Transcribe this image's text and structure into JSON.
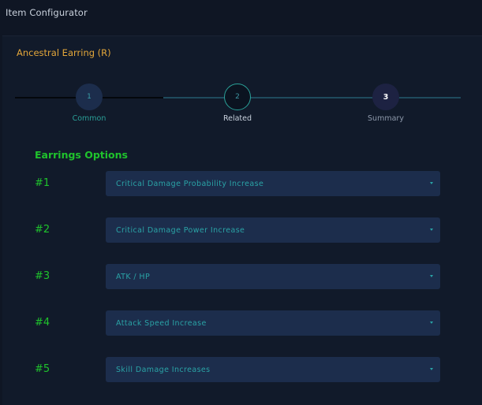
{
  "app": {
    "title": "Item Configurator"
  },
  "item": {
    "title": "Ancestral Earring (R)"
  },
  "stepper": {
    "steps": [
      {
        "number": "1",
        "label": "Common"
      },
      {
        "number": "2",
        "label": "Related"
      },
      {
        "number": "3",
        "label": "Summary"
      }
    ]
  },
  "options": {
    "heading": "Earrings Options",
    "rows": [
      {
        "number": "#1",
        "value": "Critical Damage Probability Increase"
      },
      {
        "number": "#2",
        "value": "Critical Damage Power Increase"
      },
      {
        "number": "#3",
        "value": "ATK / HP"
      },
      {
        "number": "#4",
        "value": "Attack Speed Increase"
      },
      {
        "number": "#5",
        "value": "Skill Damage Increases"
      }
    ]
  },
  "colors": {
    "background": "#0f1624",
    "panel": "#111a2a",
    "accent_teal": "#2aa198",
    "accent_green": "#1fc32c",
    "accent_orange": "#e3a63a",
    "select_bg": "#1c2d4c"
  }
}
